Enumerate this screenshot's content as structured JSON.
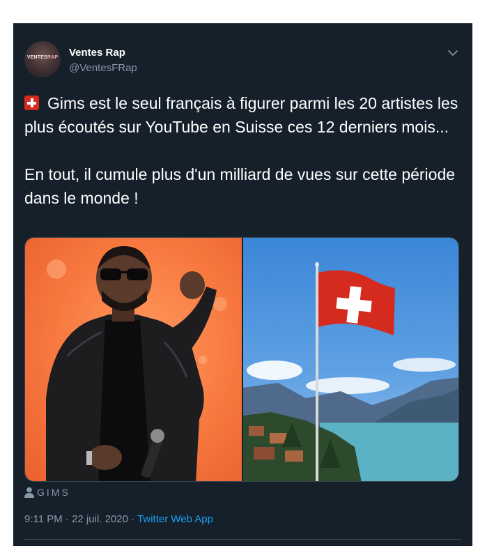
{
  "account": {
    "name": "Ventes Rap",
    "handle": "@VentesFRap",
    "avatar_text_main": "VENTES",
    "avatar_text_accent": "RAP"
  },
  "tweet": {
    "line1": "Gims est le seul français à figurer parmi les 20 artistes les plus écoutés sur YouTube en Suisse ces 12 derniers mois...",
    "line2": "En tout, il cumule plus d'un milliard de vues sur cette période dans le monde !",
    "emoji": "swiss-flag"
  },
  "media": {
    "left_image": "gims-photo",
    "right_image": "swiss-flag-lake-photo"
  },
  "tagged_user": "GIMS",
  "footer": {
    "time": "9:11 PM · 22 juil. 2020 · ",
    "source": "Twitter Web App"
  },
  "colors": {
    "background": "#15202b",
    "text": "#ffffff",
    "muted": "#8899a6",
    "link": "#1da1f2",
    "swiss_red": "#d52b1e"
  }
}
